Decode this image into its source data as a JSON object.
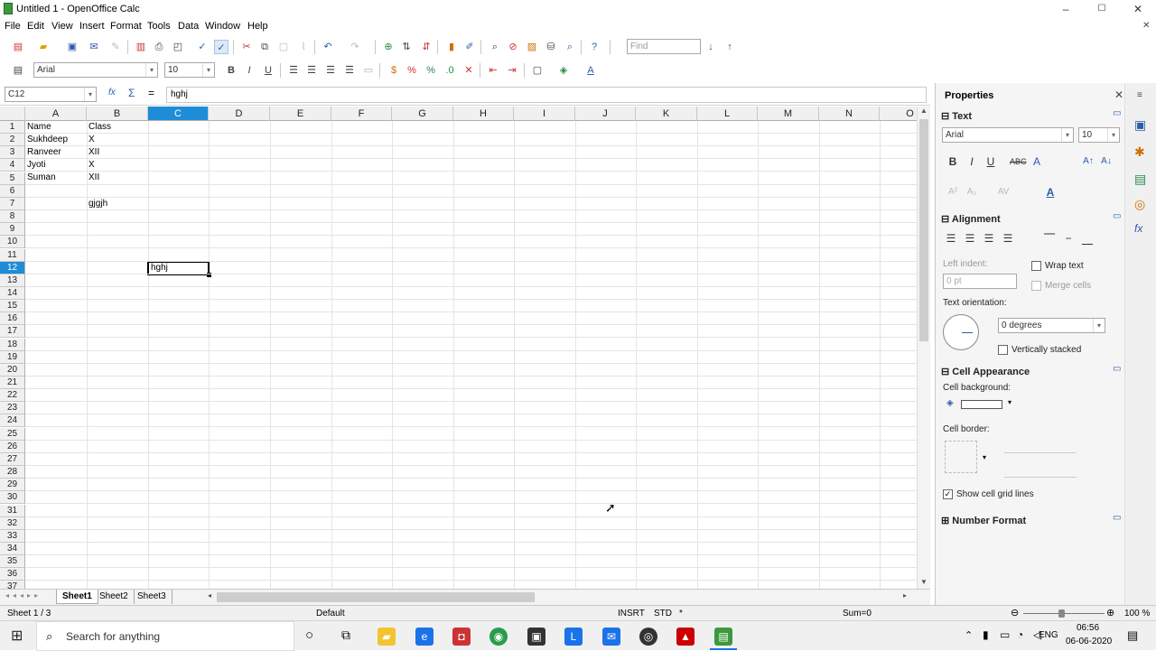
{
  "window": {
    "title": "Untitled 1 - OpenOffice Calc",
    "min": "–",
    "max": "☐",
    "close": "✕"
  },
  "menu": [
    "File",
    "Edit",
    "View",
    "Insert",
    "Format",
    "Tools",
    "Data",
    "Window",
    "Help"
  ],
  "find": {
    "placeholder": "Find"
  },
  "format_bar": {
    "font": "Arial",
    "size": "10"
  },
  "formula_bar": {
    "cell_ref": "C12",
    "content": "hghj",
    "fx": "fx",
    "sum": "Σ",
    "eq": "="
  },
  "columns": [
    "A",
    "B",
    "C",
    "D",
    "E",
    "F",
    "G",
    "H",
    "I",
    "J",
    "K",
    "L",
    "M",
    "N",
    "O"
  ],
  "rows": [
    "1",
    "2",
    "3",
    "4",
    "5",
    "6",
    "7",
    "8",
    "9",
    "10",
    "11",
    "12",
    "13",
    "14",
    "15",
    "16",
    "17",
    "18",
    "19",
    "20",
    "21",
    "22",
    "23",
    "24",
    "25",
    "26",
    "27",
    "28",
    "29",
    "30",
    "31",
    "32",
    "33",
    "34",
    "35",
    "36",
    "37"
  ],
  "cells": {
    "a1": "Name",
    "b1": "Class",
    "a2": "Sukhdeep",
    "b2": "X",
    "a3": "Ranveer",
    "b3": "XII",
    "a4": "Jyoti",
    "b4": "X",
    "a5": "Suman",
    "b5": "XII",
    "b7": "gjgjh",
    "c12": "hghj"
  },
  "sheets": [
    "Sheet1",
    "Sheet2",
    "Sheet3"
  ],
  "status": {
    "sheet": "Sheet 1 / 3",
    "style": "Default",
    "mode": "INSRT",
    "sel": "STD",
    "modified": "*",
    "sum": "Sum=0",
    "zoom": "100 %"
  },
  "properties": {
    "title": "Properties",
    "text_section": "Text",
    "font": "Arial",
    "size": "10",
    "bold": "B",
    "italic": "I",
    "underline": "U",
    "alignment_section": "Alignment",
    "left_indent": "Left indent:",
    "indent_value": "0 pt",
    "wrap_text": "Wrap text",
    "merge_cells": "Merge cells",
    "text_orientation": "Text orientation:",
    "orientation_value": "0 degrees",
    "vertically_stacked": "Vertically stacked",
    "cell_appearance": "Cell Appearance",
    "cell_background": "Cell background:",
    "cell_border": "Cell border:",
    "show_grid": "Show cell grid lines",
    "number_format": "Number Format"
  },
  "taskbar": {
    "search": "Search for anything",
    "lang": "ENG",
    "time": "06:56",
    "date": "06-06-2020"
  }
}
